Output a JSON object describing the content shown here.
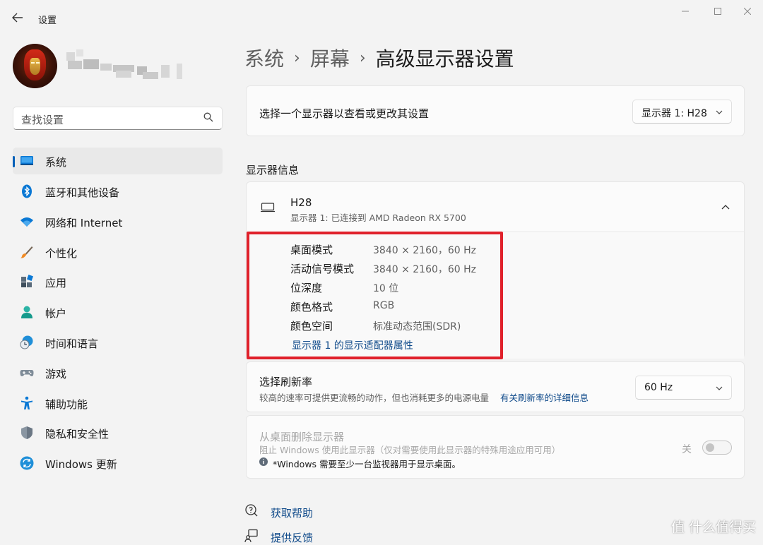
{
  "window": {
    "title": "设置",
    "controls": [
      "minimize-icon",
      "maximize-icon",
      "close-icon"
    ]
  },
  "search": {
    "placeholder": "查找设置"
  },
  "sidebar": {
    "items": [
      {
        "label": "系统",
        "icon": "system-display-icon",
        "active": true
      },
      {
        "label": "蓝牙和其他设备",
        "icon": "bluetooth-icon"
      },
      {
        "label": "网络和 Internet",
        "icon": "wifi-icon"
      },
      {
        "label": "个性化",
        "icon": "paintbrush-icon"
      },
      {
        "label": "应用",
        "icon": "apps-icon"
      },
      {
        "label": "帐户",
        "icon": "account-icon"
      },
      {
        "label": "时间和语言",
        "icon": "time-language-icon"
      },
      {
        "label": "游戏",
        "icon": "gamepad-icon"
      },
      {
        "label": "辅助功能",
        "icon": "accessibility-icon"
      },
      {
        "label": "隐私和安全性",
        "icon": "shield-icon"
      },
      {
        "label": "Windows 更新",
        "icon": "windows-update-icon"
      }
    ]
  },
  "breadcrumb": {
    "parts": [
      "系统",
      "屏幕"
    ],
    "current": "高级显示器设置"
  },
  "select_display": {
    "label": "选择一个显示器以查看或更改其设置",
    "value": "显示器 1: H28"
  },
  "display_info": {
    "section_title": "显示器信息",
    "monitor_name": "H28",
    "monitor_subtitle": "显示器 1: 已连接到 AMD Radeon RX 5700",
    "rows": [
      {
        "key": "桌面模式",
        "value": "3840 × 2160，60 Hz"
      },
      {
        "key": "活动信号模式",
        "value": "3840 × 2160，60 Hz"
      },
      {
        "key": "位深度",
        "value": "10 位"
      },
      {
        "key": "颜色格式",
        "value": "RGB"
      },
      {
        "key": "颜色空间",
        "value": "标准动态范围(SDR)"
      }
    ],
    "adapter_link": "显示器 1 的显示适配器属性"
  },
  "refresh_rate": {
    "title": "选择刷新率",
    "description": "较高的速率可提供更流畅的动作，但也消耗更多的电源电量",
    "details_link": "有关刷新率的详细信息",
    "value": "60 Hz"
  },
  "remove_display": {
    "title": "从桌面删除显示器",
    "description": "阻止 Windows 使用此显示器（仅对需要使用此显示器的特殊用途应用可用）",
    "note": "*Windows 需要至少一台监视器用于显示桌面。",
    "toggle_label": "关",
    "toggle_on": false
  },
  "footer": {
    "help": "获取帮助",
    "feedback": "提供反馈"
  },
  "watermark": "值 什么值得买",
  "colors": {
    "accent": "#005fb8",
    "link": "#0f4a8a",
    "highlight_box": "#e0212b"
  }
}
